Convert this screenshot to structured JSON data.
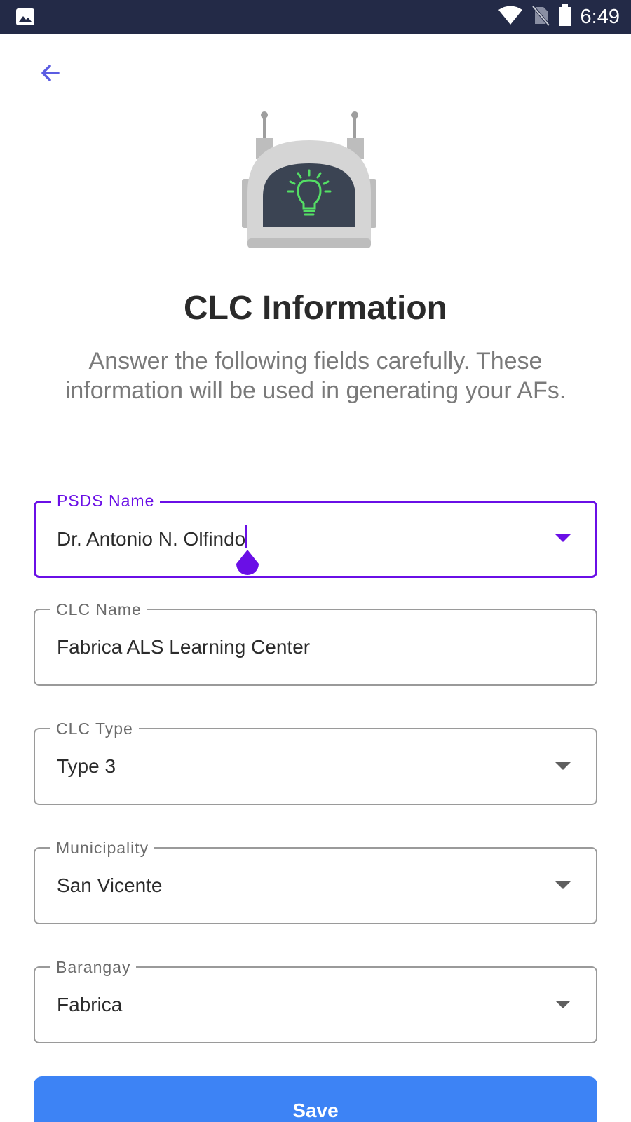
{
  "status_bar": {
    "time": "6:49",
    "icons": [
      "gallery-icon",
      "wifi-icon",
      "no-sim-icon",
      "battery-icon"
    ]
  },
  "header": {
    "back_icon": "arrow-left-icon"
  },
  "hero": {
    "icon": "robot-lightbulb-icon"
  },
  "title": "CLC Information",
  "subtitle": "Answer the following fields carefully. These information will be used in generating your AFs.",
  "fields": [
    {
      "label": "PSDS Name",
      "value": "Dr. Antonio N. Olfindo",
      "type": "dropdown",
      "focused": true
    },
    {
      "label": "CLC Name",
      "value": "Fabrica ALS Learning Center",
      "type": "text",
      "focused": false
    },
    {
      "label": "CLC Type",
      "value": "Type 3",
      "type": "dropdown",
      "focused": false
    },
    {
      "label": "Municipality",
      "value": "San Vicente",
      "type": "dropdown",
      "focused": false
    },
    {
      "label": "Barangay",
      "value": "Fabrica",
      "type": "dropdown",
      "focused": false
    }
  ],
  "save_label": "Save",
  "colors": {
    "accent": "#6a0fe6",
    "status_bar": "#232a47",
    "save_button": "#3d83f5",
    "back_arrow": "#5b5ce2"
  }
}
